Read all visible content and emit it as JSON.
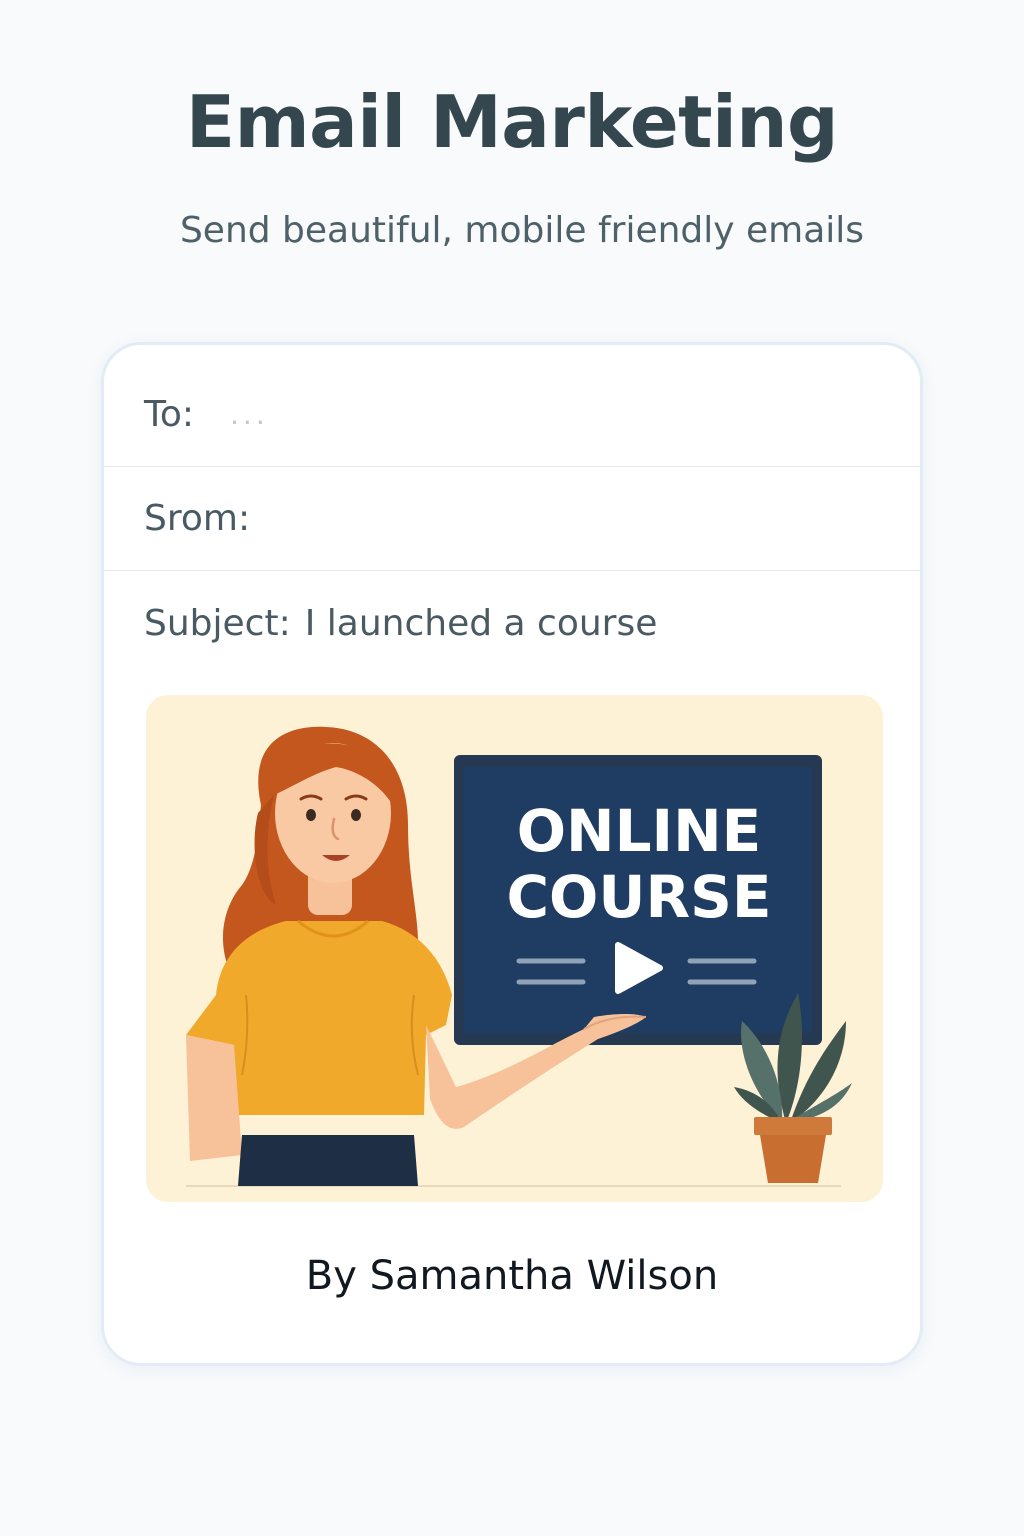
{
  "header": {
    "title": "Email Marketing",
    "subtitle": "Send beautiful, mobile friendly emails"
  },
  "email": {
    "to_label": "To:",
    "to_placeholder": "...",
    "from_label": "Srom:",
    "subject_label": "Subject:",
    "subject_value": "I launched a course",
    "hero": {
      "screen_line_1": "ONLINE",
      "screen_line_2": "COURSE",
      "icons": [
        "play-icon",
        "plant-icon",
        "presenter-illustration"
      ]
    },
    "author": "By Samantha Wilson"
  },
  "colors": {
    "title": "#34474f",
    "subtitle": "#4f6168",
    "card_border": "#e3ebf6",
    "hero_background": "#fdf1d6",
    "screen_navy": "#1f3d63",
    "shirt_yellow": "#f1a92c",
    "hair_auburn": "#c4571e"
  }
}
